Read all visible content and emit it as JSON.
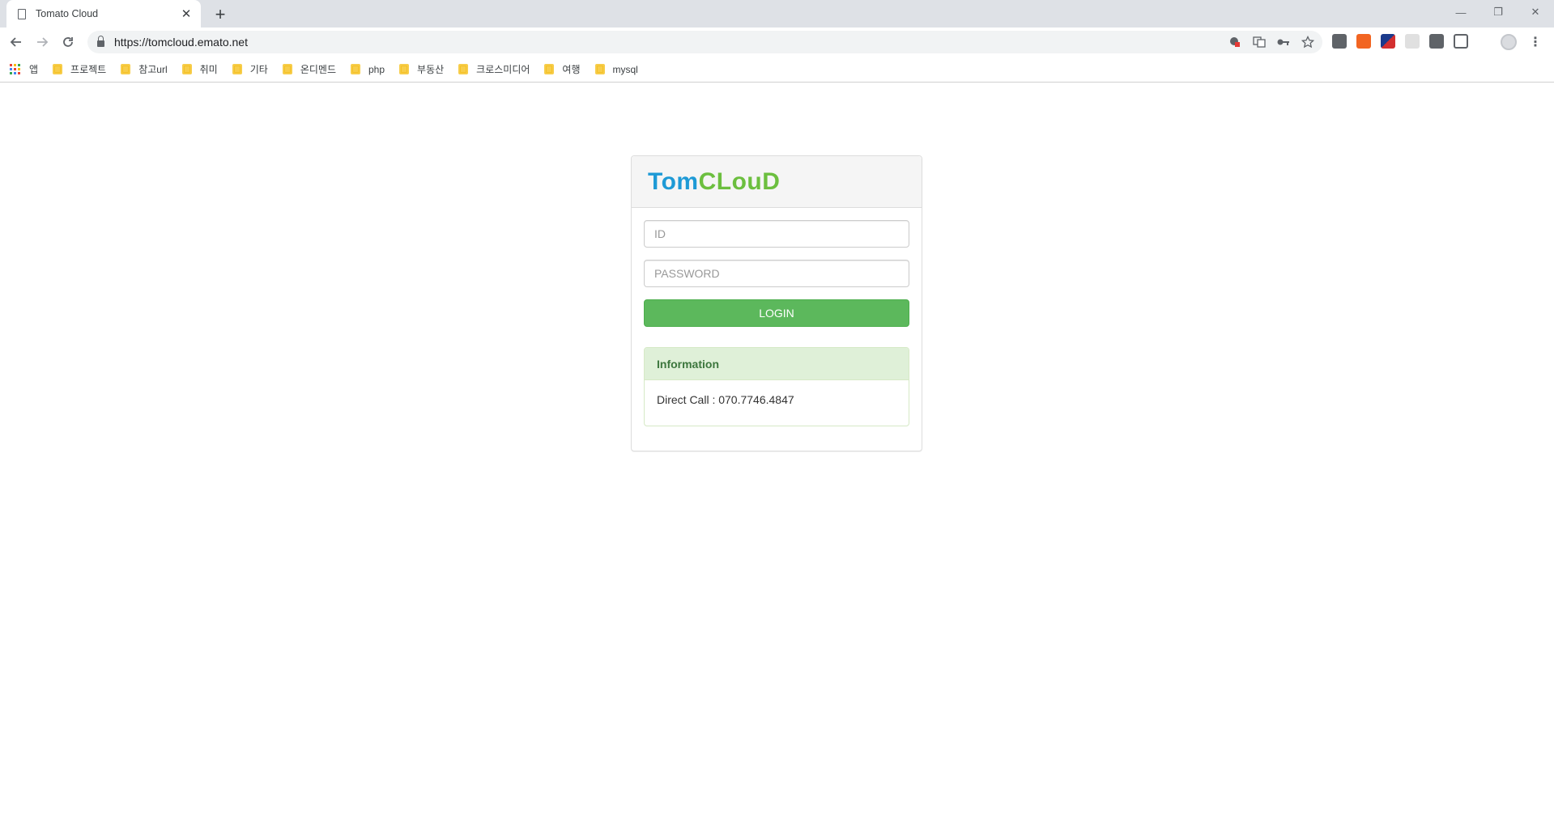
{
  "browser": {
    "tab_title": "Tomato Cloud",
    "new_tab_symbol": "+",
    "close_symbol": "✕",
    "url": "https://tomcloud.emato.net",
    "window_controls": [
      "—",
      "❐",
      "✕"
    ]
  },
  "bookmarks": [
    {
      "label": "앱",
      "icon": "apps-icon"
    },
    {
      "label": "프로젝트",
      "icon": "folder-icon"
    },
    {
      "label": "참고url",
      "icon": "folder-icon"
    },
    {
      "label": "취미",
      "icon": "folder-icon"
    },
    {
      "label": "기타",
      "icon": "folder-icon"
    },
    {
      "label": "온디멘드",
      "icon": "folder-icon"
    },
    {
      "label": "php",
      "icon": "folder-icon"
    },
    {
      "label": "부동산",
      "icon": "folder-icon"
    },
    {
      "label": "크로스미디어",
      "icon": "folder-icon"
    },
    {
      "label": "여행",
      "icon": "folder-icon"
    },
    {
      "label": "mysql",
      "icon": "folder-icon"
    }
  ],
  "login": {
    "logo_part1": "Tom",
    "logo_part2": "CLouD",
    "id_placeholder": "ID",
    "password_placeholder": "PASSWORD",
    "login_label": "LOGIN"
  },
  "info": {
    "heading": "Information",
    "body": "Direct Call : 070.7746.4847"
  },
  "colors": {
    "logo_blue": "#1e9ad6",
    "logo_green": "#6cbf3f",
    "login_button": "#5cb85c",
    "info_heading_bg": "#dff0d8",
    "info_heading_text": "#3c763d"
  }
}
